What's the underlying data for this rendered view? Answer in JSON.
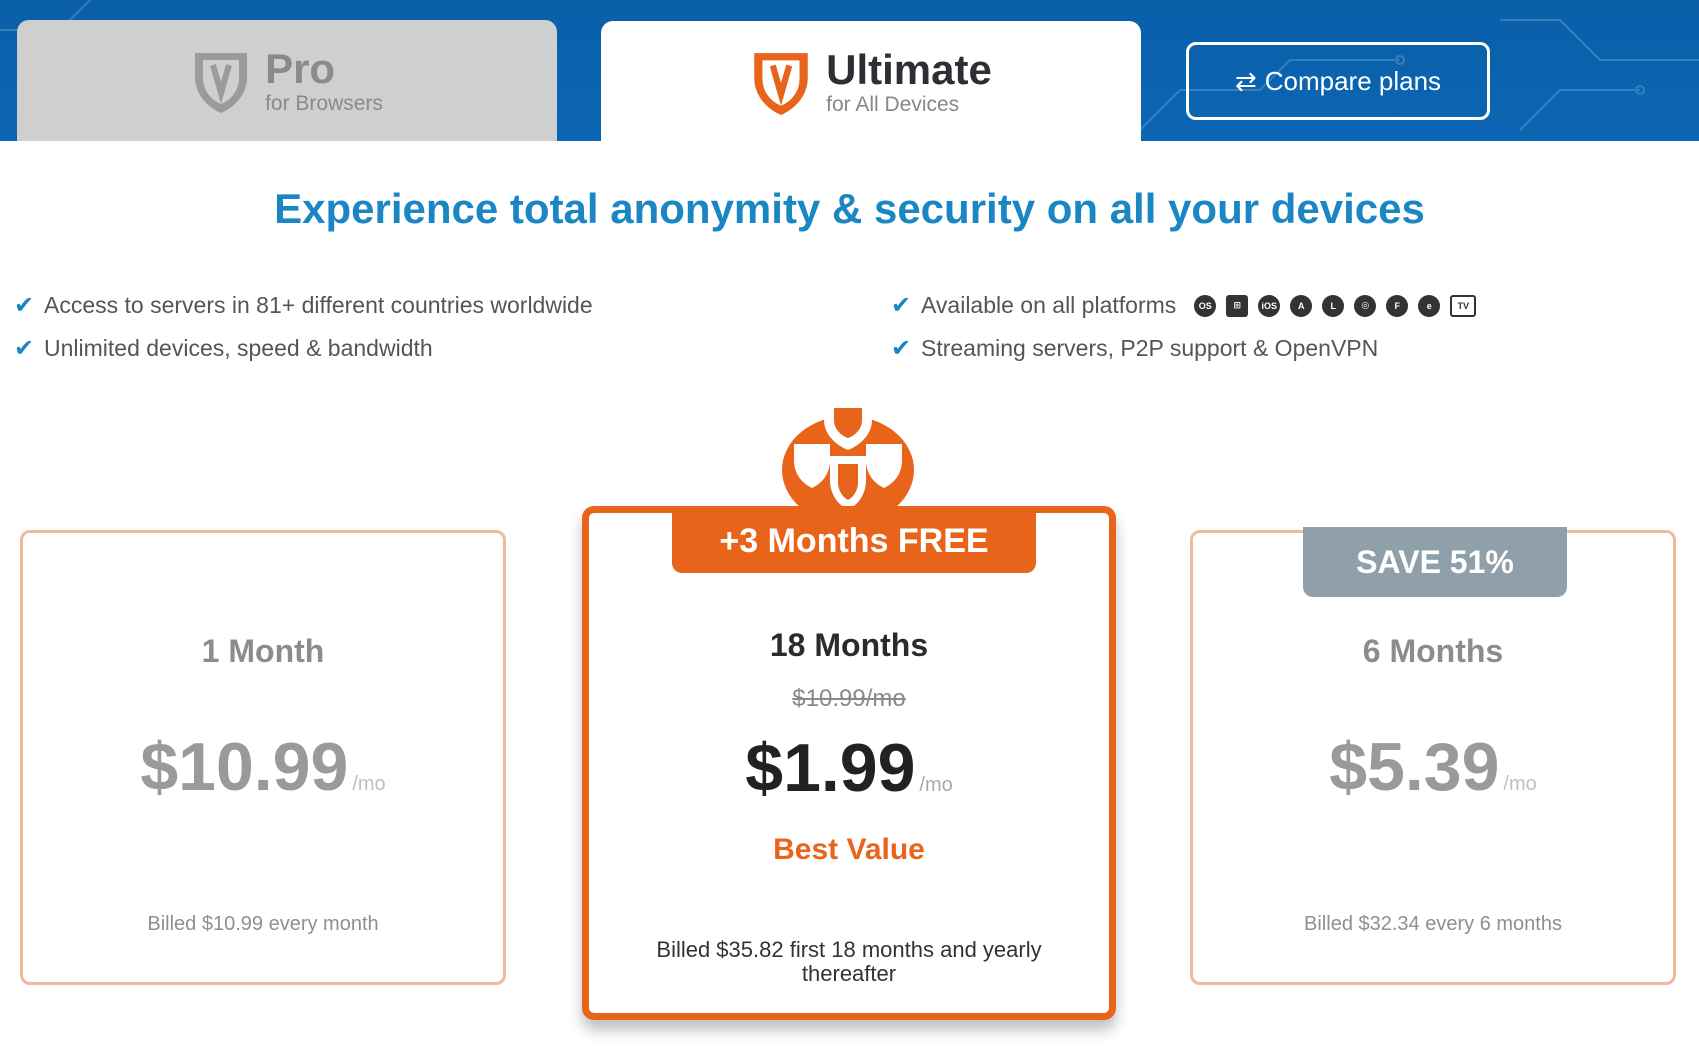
{
  "tabs": {
    "pro": {
      "title": "Pro",
      "subtitle": "for Browsers"
    },
    "ultimate": {
      "title": "Ultimate",
      "subtitle": "for All Devices"
    }
  },
  "compare_button": {
    "label": "Compare plans"
  },
  "headline": "Experience total anonymity & security on all your devices",
  "features": {
    "left": [
      "Access to servers in 81+ different countries worldwide",
      "Unlimited devices, speed & bandwidth"
    ],
    "right": [
      "Available on all platforms",
      "Streaming servers, P2P support & OpenVPN"
    ]
  },
  "platform_icons": [
    "macos-icon",
    "windows-icon",
    "ios-icon",
    "android-icon",
    "linux-icon",
    "chrome-icon",
    "firefox-icon",
    "edge-icon",
    "tv-icon"
  ],
  "plans": [
    {
      "term": "1 Month",
      "currency": "$",
      "price": "10.99",
      "per": "/mo",
      "billed": "Billed $10.99 every month"
    },
    {
      "ribbon": "+3 Months FREE",
      "term": "18 Months",
      "original_price": "$10.99/mo",
      "currency": "$",
      "price": "1.99",
      "per": "/mo",
      "tagline": "Best Value",
      "billed": "Billed $35.82 first 18 months and yearly thereafter"
    },
    {
      "badge": "SAVE 51%",
      "term": "6 Months",
      "currency": "$",
      "price": "5.39",
      "per": "/mo",
      "billed": "Billed $32.34 every 6 months"
    }
  ],
  "colors": {
    "brand_blue": "#0b66b3",
    "headline_blue": "#1b86c4",
    "accent_orange": "#e8641b",
    "save_gray": "#8fa0ab"
  }
}
